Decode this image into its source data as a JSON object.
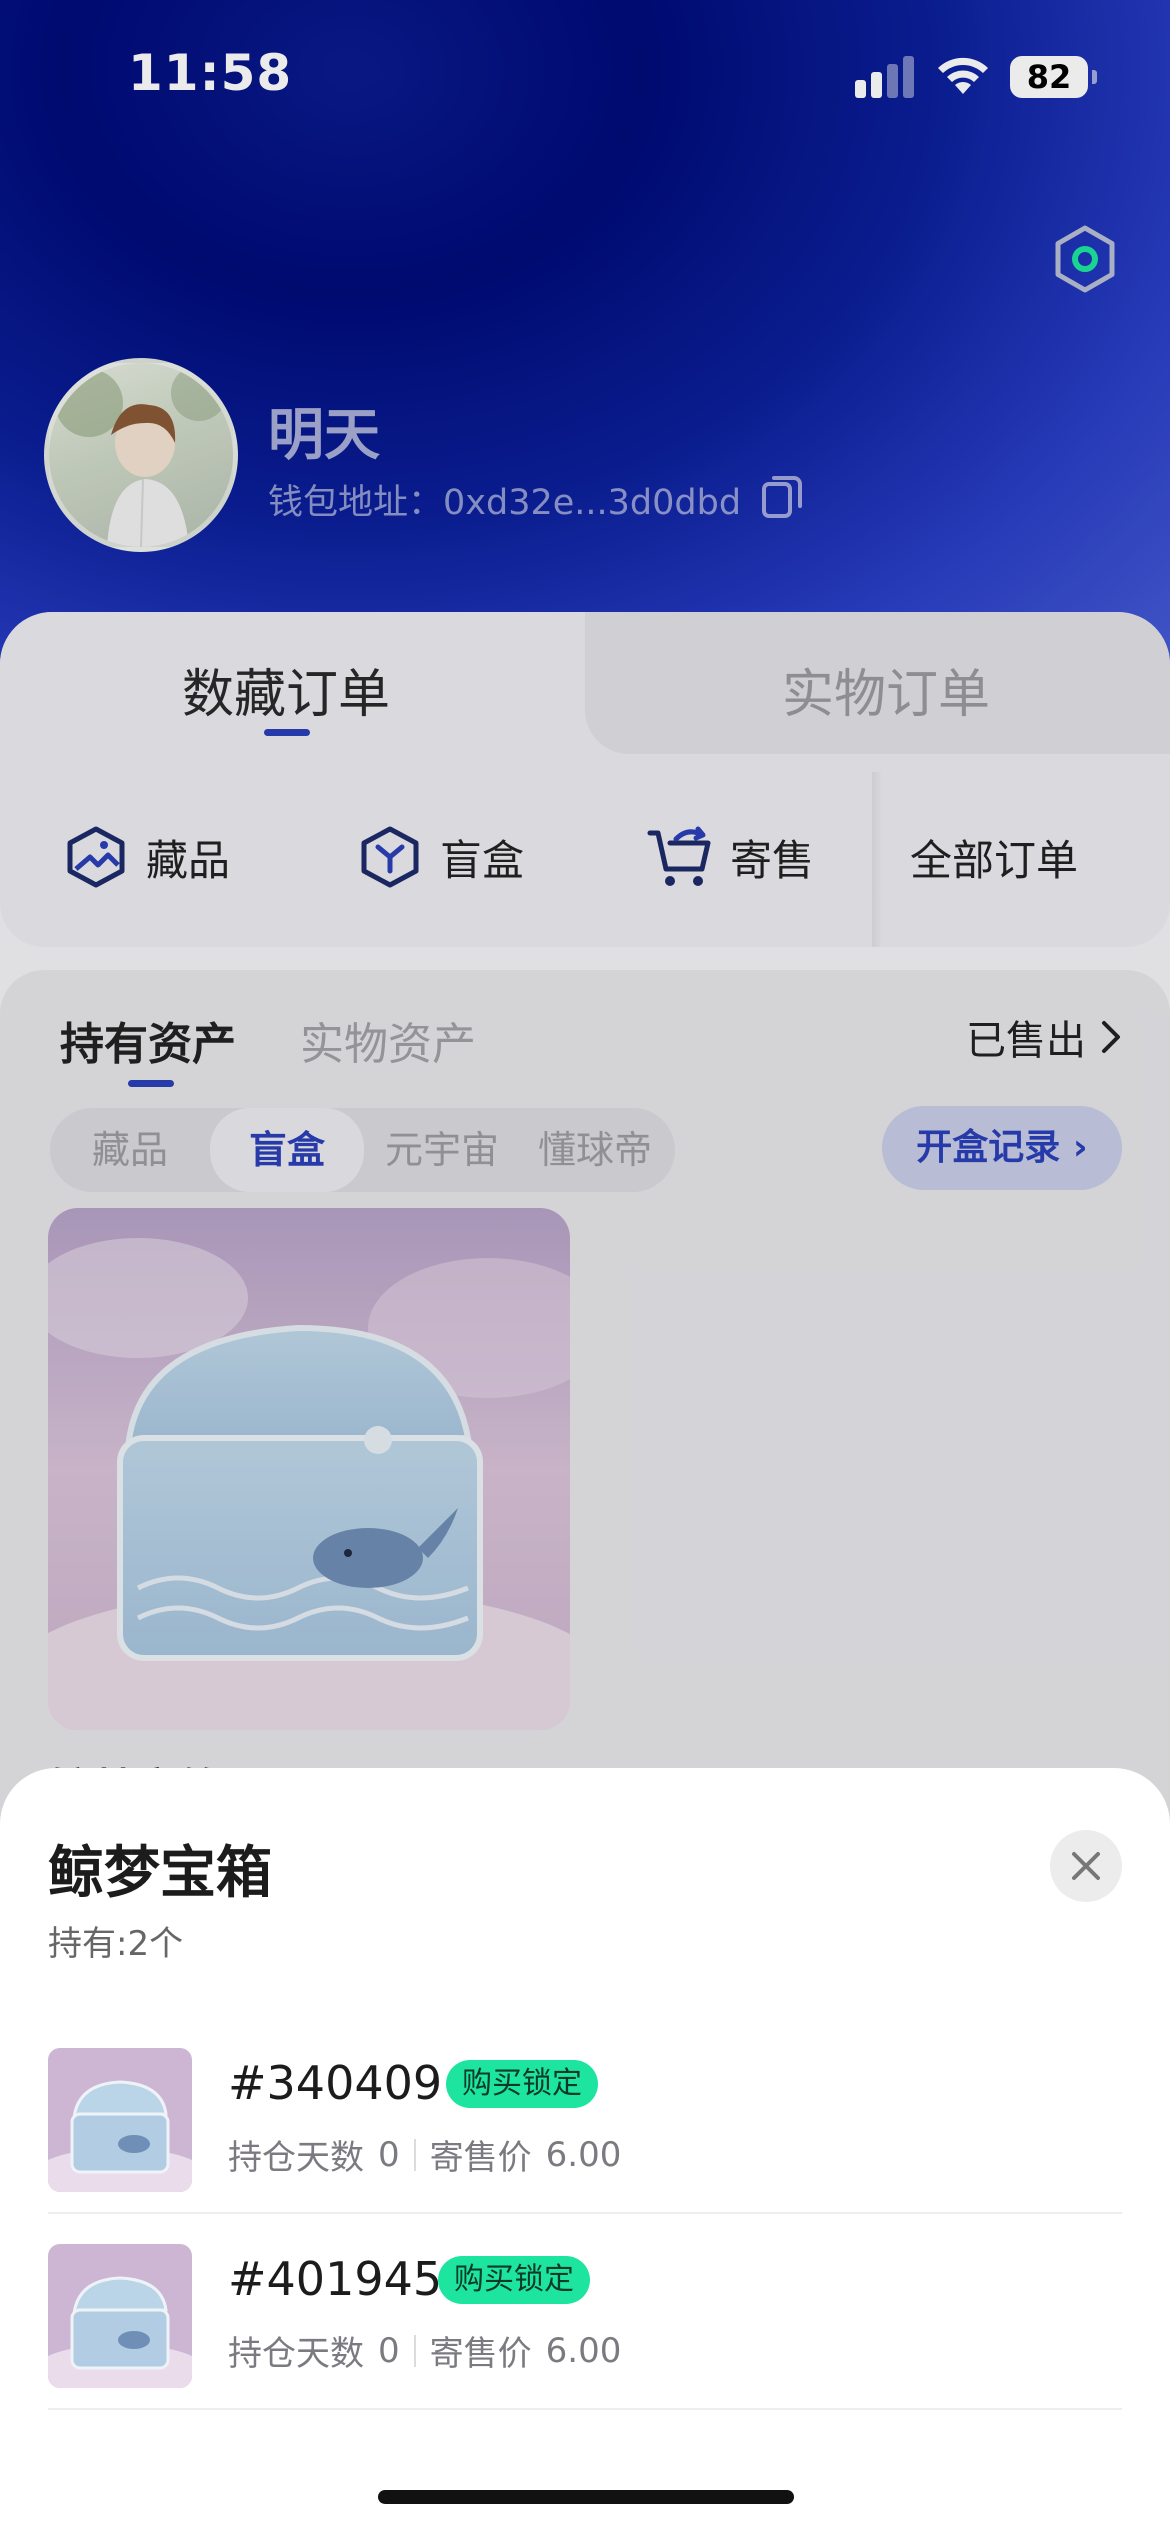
{
  "status_bar": {
    "time": "11:58",
    "battery": "82"
  },
  "profile": {
    "name": "明天",
    "wallet_label": "钱包地址：",
    "wallet_address": "0xd32e...3d0dbd"
  },
  "order_tabs": {
    "active": "数藏订单",
    "inactive": "实物订单"
  },
  "order_categories": [
    {
      "label": "藏品",
      "icon": "collection-icon"
    },
    {
      "label": "盲盒",
      "icon": "blindbox-icon"
    },
    {
      "label": "寄售",
      "icon": "cart-icon"
    },
    {
      "label": "全部订单"
    }
  ],
  "assets": {
    "tab_hold": "持有资产",
    "tab_physical": "实物资产",
    "sold": "已售出",
    "filters": [
      "藏品",
      "盲盒",
      "元宇宙",
      "懂球帝"
    ],
    "active_filter": "盲盒",
    "open_record": "开盒记录",
    "box_name_peek": "鲸梦宝箱"
  },
  "sheet": {
    "title": "鲸梦宝箱",
    "subtitle": "持有:2个",
    "items": [
      {
        "id": "#340409",
        "badge": "购买锁定",
        "days_label": "持仓天数",
        "days": "0",
        "price_label": "寄售价",
        "price": "6.00"
      },
      {
        "id": "#401945",
        "badge": "购买锁定",
        "days_label": "持仓天数",
        "days": "0",
        "price_label": "寄售价",
        "price": "6.00"
      }
    ]
  },
  "colors": {
    "accent": "#2b3fb8",
    "badge": "#1de5a0",
    "header_dark": "#000c7a"
  }
}
